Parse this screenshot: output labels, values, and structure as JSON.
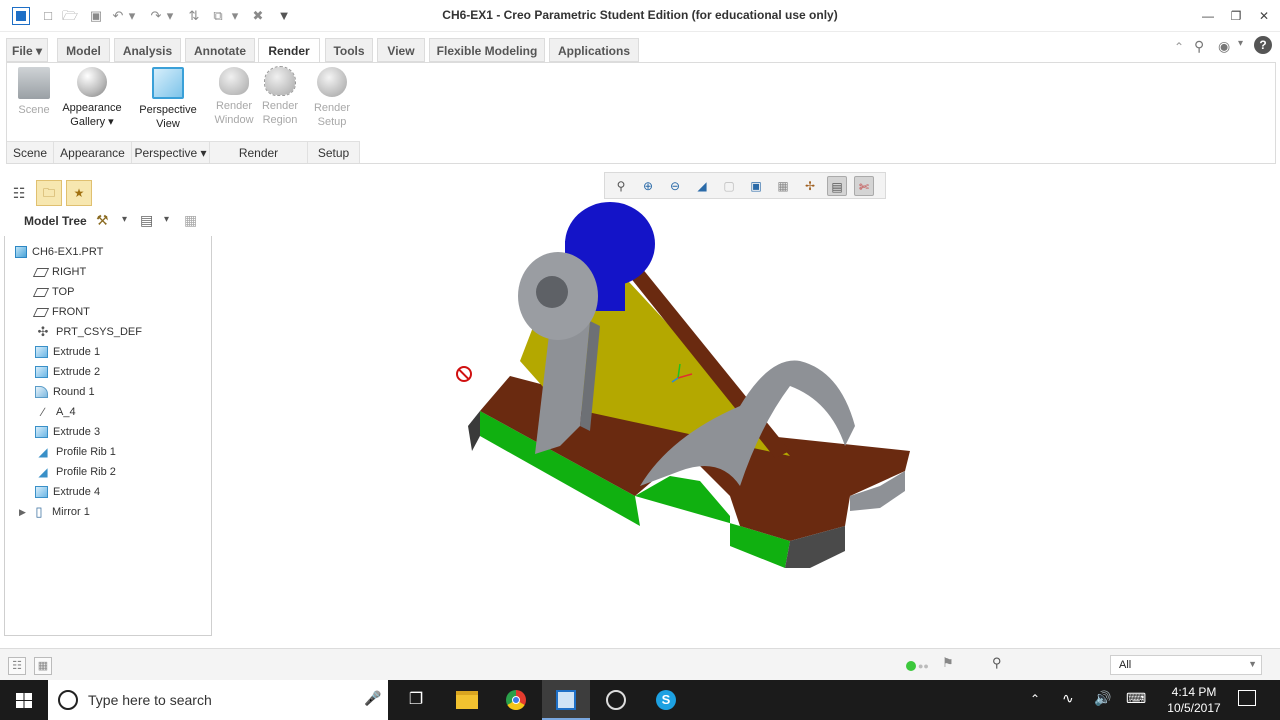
{
  "window": {
    "title": "CH6-EX1 - Creo Parametric Student Edition (for educational use only)"
  },
  "ribbon": {
    "tabs": [
      {
        "label": "File ▾"
      },
      {
        "label": "Model"
      },
      {
        "label": "Analysis"
      },
      {
        "label": "Annotate"
      },
      {
        "label": "Render"
      },
      {
        "label": "Tools"
      },
      {
        "label": "View"
      },
      {
        "label": "Flexible Modeling"
      },
      {
        "label": "Applications"
      }
    ],
    "buttons": {
      "scene": "Scene",
      "appearance_gallery_1": "Appearance",
      "appearance_gallery_2": "Gallery ▾",
      "perspective_view_1": "Perspective",
      "perspective_view_2": "View",
      "render_window_1": "Render",
      "render_window_2": "Window",
      "render_region_1": "Render",
      "render_region_2": "Region",
      "render_setup_1": "Render",
      "render_setup_2": "Setup"
    },
    "groups": {
      "scene": "Scene",
      "appearance": "Appearance",
      "perspective": "Perspective ▾",
      "render": "Render",
      "setup": "Setup"
    }
  },
  "model_tree": {
    "header": "Model Tree",
    "items": [
      {
        "label": "CH6-EX1.PRT",
        "icon": "part-icon"
      },
      {
        "label": "RIGHT",
        "icon": "datum-plane-icon"
      },
      {
        "label": "TOP",
        "icon": "datum-plane-icon"
      },
      {
        "label": "FRONT",
        "icon": "datum-plane-icon"
      },
      {
        "label": "PRT_CSYS_DEF",
        "icon": "csys-icon"
      },
      {
        "label": "Extrude 1",
        "icon": "extrude-icon"
      },
      {
        "label": "Extrude 2",
        "icon": "extrude-icon"
      },
      {
        "label": "Round 1",
        "icon": "round-icon"
      },
      {
        "label": "A_4",
        "icon": "axis-icon"
      },
      {
        "label": "Extrude 3",
        "icon": "extrude-icon"
      },
      {
        "label": "Profile Rib 1",
        "icon": "rib-icon"
      },
      {
        "label": "Profile Rib 2",
        "icon": "rib-icon"
      },
      {
        "label": "Extrude 4",
        "icon": "extrude-icon"
      },
      {
        "label": "Mirror 1",
        "icon": "mirror-icon"
      }
    ]
  },
  "status_bar": {
    "filter_value": "All"
  },
  "taskbar": {
    "search_placeholder": "Type here to search",
    "time": "4:14 PM",
    "date": "10/5/2017"
  },
  "colors": {
    "accent_blue": "#1e6fc6",
    "model_blue": "#1414c8",
    "model_yellow": "#b4a800",
    "model_green": "#10b010",
    "model_brown": "#6a2a10",
    "model_grey": "#8e9196"
  }
}
